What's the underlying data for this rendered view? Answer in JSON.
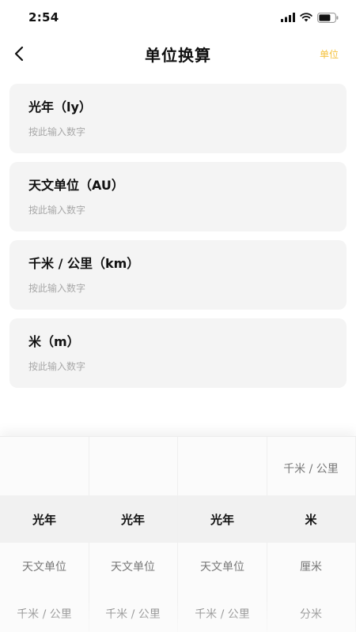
{
  "status_bar": {
    "time": "2:54"
  },
  "nav": {
    "title": "单位换算",
    "action_label": "单位"
  },
  "cards": [
    {
      "label": "光年（ly）",
      "placeholder": "按此输入数字"
    },
    {
      "label": "天文单位（AU）",
      "placeholder": "按此输入数字"
    },
    {
      "label": "千米 / 公里（km）",
      "placeholder": "按此输入数字"
    },
    {
      "label": "米（m）",
      "placeholder": "按此输入数字"
    }
  ],
  "picker": {
    "columns": [
      {
        "items": [
          "",
          "光年",
          "天文单位",
          "千米 / 公里"
        ],
        "selected_index": 1
      },
      {
        "items": [
          "",
          "光年",
          "天文单位",
          "千米 / 公里"
        ],
        "selected_index": 1
      },
      {
        "items": [
          "",
          "光年",
          "天文单位",
          "千米 / 公里"
        ],
        "selected_index": 1
      },
      {
        "items": [
          "千米 / 公里",
          "米",
          "厘米",
          "分米"
        ],
        "selected_index": 1
      }
    ]
  },
  "colors": {
    "accent": "#f5c23e",
    "card_bg": "#f4f4f4",
    "placeholder": "#a8a8a8"
  }
}
